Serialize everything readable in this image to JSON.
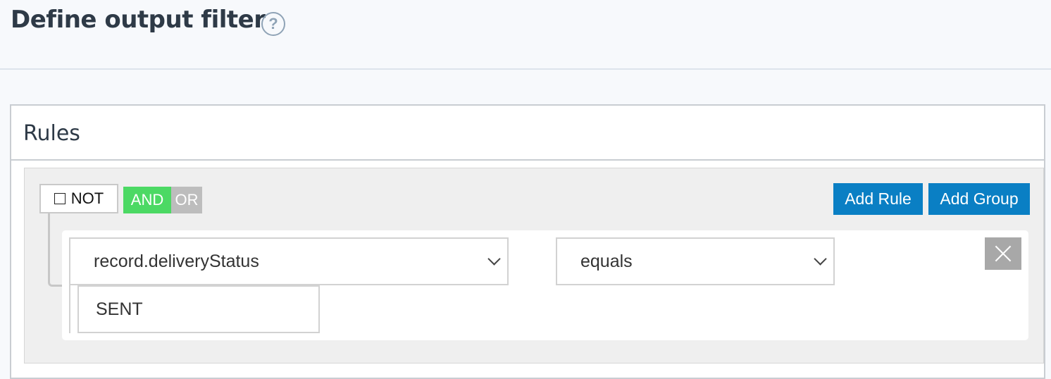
{
  "header": {
    "title": "Define output filter",
    "help_glyph": "?"
  },
  "rules_panel": {
    "title": "Rules"
  },
  "group": {
    "not_label": "NOT",
    "not_checked": false,
    "conjunction": {
      "and_label": "AND",
      "or_label": "OR",
      "selected": "AND"
    },
    "add_rule_label": "Add Rule",
    "add_group_label": "Add Group",
    "colors": {
      "and_active": "#4cd964",
      "or_inactive": "#bdbdbd",
      "button_primary": "#0a7fc4",
      "delete_button": "#a8a8a8"
    }
  },
  "rule": {
    "field_value": "record.deliveryStatus",
    "operator_value": "equals",
    "value": "SENT",
    "icons": {
      "field_dropdown": "chevron-down-icon",
      "operator_dropdown": "chevron-down-icon",
      "delete": "close-icon"
    }
  }
}
